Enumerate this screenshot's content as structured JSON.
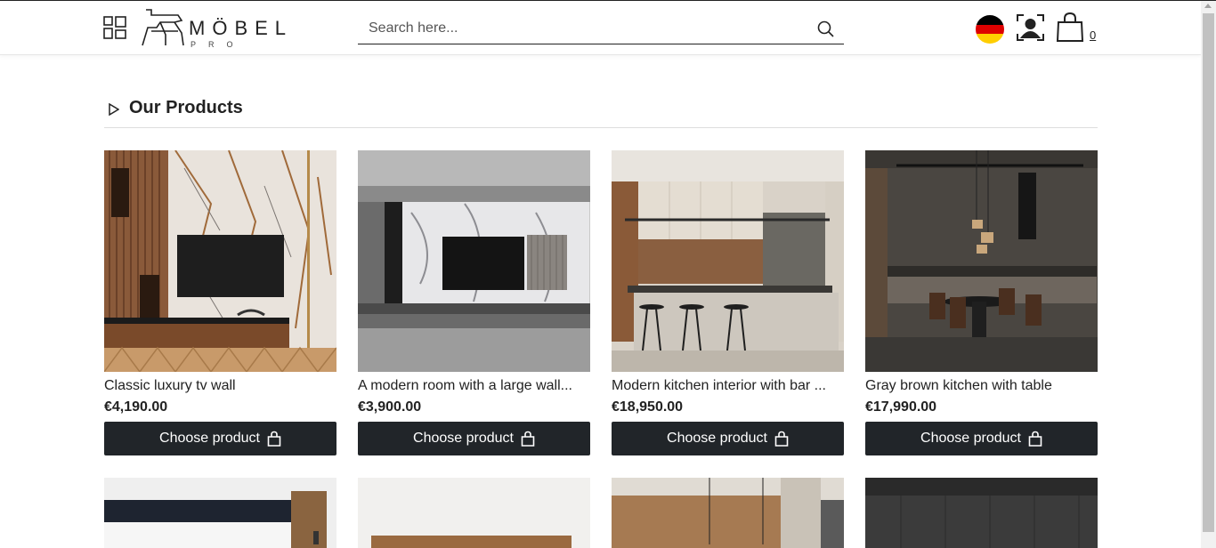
{
  "header": {
    "logo_text": "MÖBEL",
    "logo_sub": "PRO",
    "search_placeholder": "Search here...",
    "cart_count": "0",
    "flag_colors": [
      "#000000",
      "#dd0000",
      "#ffce00"
    ]
  },
  "section": {
    "title": "Our Products"
  },
  "products": [
    {
      "name": "Classic luxury tv wall",
      "price": "€4,190.00",
      "button": "Choose product"
    },
    {
      "name": "A modern room with a large wall...",
      "price": "€3,900.00",
      "button": "Choose product"
    },
    {
      "name": "Modern kitchen interior with bar ...",
      "price": "€18,950.00",
      "button": "Choose product"
    },
    {
      "name": "Gray brown kitchen with table",
      "price": "€17,990.00",
      "button": "Choose product"
    }
  ],
  "colors": {
    "button_bg": "#212529",
    "text": "#222222"
  }
}
